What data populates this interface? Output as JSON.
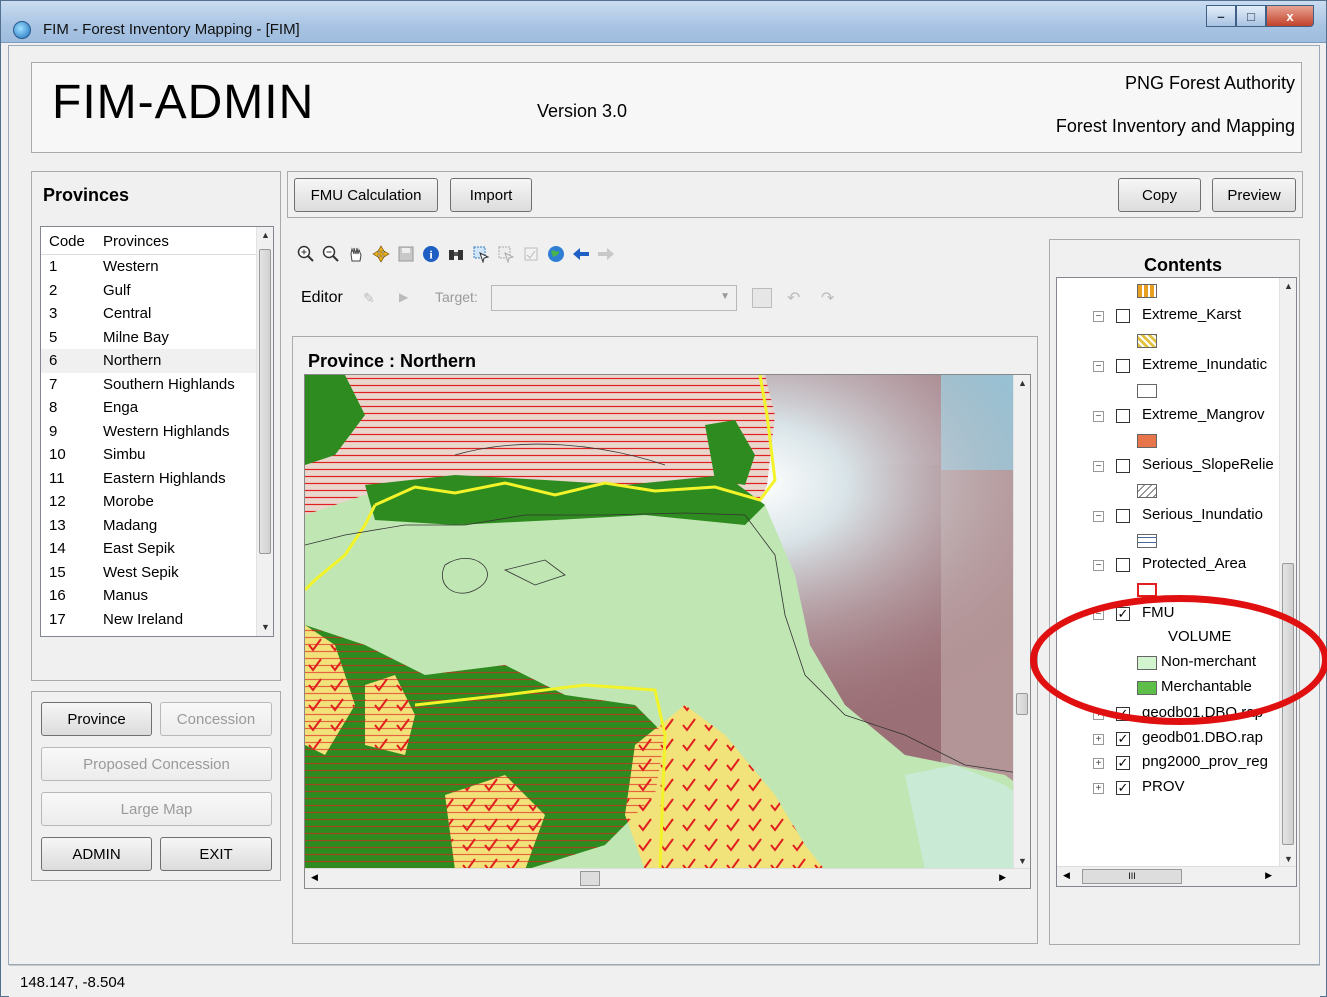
{
  "window": {
    "title": "FIM - Forest Inventory Mapping - [FIM]",
    "minimize": "–",
    "maximize": "□",
    "close": "x"
  },
  "header": {
    "app_name": "FIM-ADMIN",
    "version": "Version 3.0",
    "org_line1": "PNG Forest Authority",
    "org_line2": "Forest Inventory and Mapping"
  },
  "provinces": {
    "title": "Provinces",
    "col_code": "Code",
    "col_name": "Provinces",
    "rows": [
      {
        "code": "1",
        "name": "Western"
      },
      {
        "code": "2",
        "name": "Gulf"
      },
      {
        "code": "3",
        "name": "Central"
      },
      {
        "code": "5",
        "name": "Milne Bay"
      },
      {
        "code": "6",
        "name": "Northern"
      },
      {
        "code": "7",
        "name": "Southern Highlands"
      },
      {
        "code": "8",
        "name": "Enga"
      },
      {
        "code": "9",
        "name": "Western Highlands"
      },
      {
        "code": "10",
        "name": "Simbu"
      },
      {
        "code": "11",
        "name": "Eastern Highlands"
      },
      {
        "code": "12",
        "name": "Morobe"
      },
      {
        "code": "13",
        "name": "Madang"
      },
      {
        "code": "14",
        "name": "East Sepik"
      },
      {
        "code": "15",
        "name": "West Sepik"
      },
      {
        "code": "16",
        "name": "Manus"
      },
      {
        "code": "17",
        "name": "New Ireland"
      }
    ],
    "selected": "Northern"
  },
  "nav_buttons": {
    "province": "Province",
    "concession": "Concession",
    "proposed": "Proposed Concession",
    "large_map": "Large Map",
    "admin": "ADMIN",
    "exit": "EXIT"
  },
  "toolbar": {
    "fmu_calc": "FMU Calculation",
    "import": "Import",
    "copy": "Copy",
    "preview": "Preview"
  },
  "map_tools": [
    "zoom-in-icon",
    "zoom-out-icon",
    "pan-hand-icon",
    "full-extent-icon",
    "save-icon",
    "identify-icon",
    "find-binoculars-icon",
    "select-icon",
    "clear-select-icon",
    "measure-icon",
    "globe-icon",
    "back-arrow-icon",
    "forward-arrow-icon"
  ],
  "editor": {
    "label": "Editor",
    "target_label": "Target:"
  },
  "map": {
    "title": "Province :  Northern"
  },
  "contents": {
    "title": "Contents",
    "layers": [
      {
        "name": "Extreme_Karst",
        "checked": false
      },
      {
        "name": "Extreme_Inundatic",
        "checked": false
      },
      {
        "name": "Extreme_Mangrov",
        "checked": false
      },
      {
        "name": "Serious_SlopeRelie",
        "checked": false
      },
      {
        "name": "Serious_Inundatio",
        "checked": false
      },
      {
        "name": "Protected_Area",
        "checked": false
      },
      {
        "name": "FMU",
        "checked": true
      },
      {
        "name": "geodb01.DBO.rap",
        "checked": true
      },
      {
        "name": "geodb01.DBO.rap",
        "checked": true
      },
      {
        "name": "png2000_prov_reg",
        "checked": true
      },
      {
        "name": "PROV",
        "checked": true
      }
    ],
    "fmu_field": "VOLUME",
    "fmu_classes": [
      {
        "label": "Non-merchant",
        "color": "#d2f5cf"
      },
      {
        "label": "Merchantable",
        "color": "#5dbf4a"
      }
    ],
    "hscroll_grip": "III"
  },
  "status": {
    "coords": "148.147, -8.504"
  },
  "colors": {
    "accent_highlight": "#e01010",
    "forest_dark": "#2e8b1f",
    "forest_light": "#bfe6b3",
    "hatch": "#e02020",
    "yellow_area": "#f2e27a"
  }
}
